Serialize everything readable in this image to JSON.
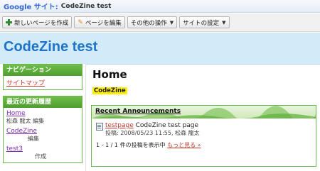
{
  "topbar": {
    "brand": "Google サイト:",
    "site_title": "CodeZine test"
  },
  "toolbar": {
    "new_page": "新しいページを作成",
    "edit_page": "ページを編集",
    "other_actions": "その他の操作",
    "site_settings": "サイトの設定"
  },
  "header": {
    "title": "CodeZine test"
  },
  "nav": {
    "heading": "ナビゲーション",
    "items": [
      {
        "label": "サイトマップ"
      }
    ]
  },
  "recent": {
    "heading": "最近の更新履歴",
    "items": [
      {
        "label": "Home",
        "meta": "松森 龍太 編集"
      },
      {
        "label": "CodeZine",
        "meta": "編集"
      },
      {
        "label": "test3",
        "meta": "作成"
      }
    ]
  },
  "main": {
    "title": "Home",
    "highlight": "CodeZine",
    "announcements": {
      "heading": "Recent Announcements",
      "item": {
        "link": "testpage",
        "text": " CodeZine test page",
        "meta": "投稿: 2008/05/23 11:55, 松森 龍太"
      },
      "footer_text": "1 - 1 / 1 件の投稿を表示中",
      "footer_link": "もっと見る »"
    }
  },
  "colors": {
    "accent_blue": "#1f74c9",
    "header_bg": "#d1ebf8",
    "green": "#6db44a"
  }
}
